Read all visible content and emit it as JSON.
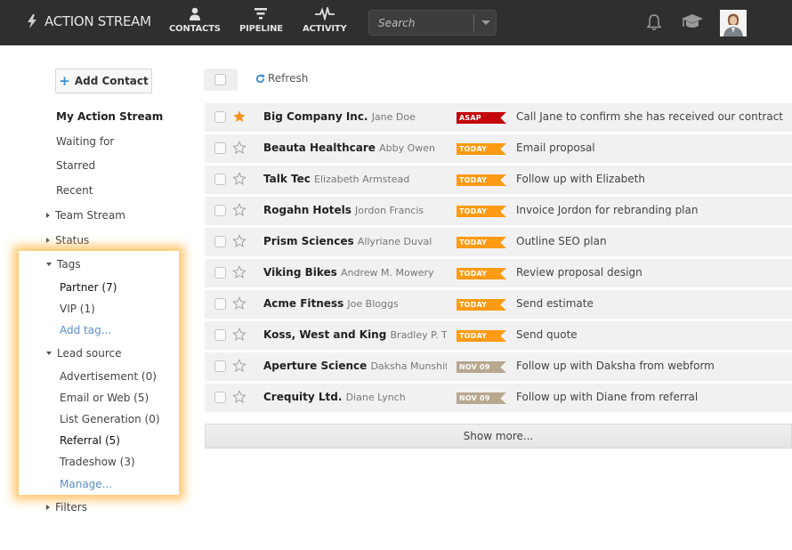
{
  "header": {
    "app_title": "ACTION STREAM",
    "nav": [
      {
        "label": "CONTACTS",
        "icon": "person-icon"
      },
      {
        "label": "PIPELINE",
        "icon": "funnel-icon"
      },
      {
        "label": "ACTIVITY",
        "icon": "pulse-icon"
      }
    ],
    "search": {
      "placeholder": "Search",
      "value": ""
    },
    "icons": [
      "bell-icon",
      "graduation-cap-icon",
      "avatar"
    ]
  },
  "sidebar": {
    "add_contact_label": "Add Contact",
    "items": [
      {
        "label": "My Action Stream",
        "active": true
      },
      {
        "label": "Waiting for"
      },
      {
        "label": "Starred"
      },
      {
        "label": "Recent"
      }
    ],
    "team_stream": "Team Stream",
    "status": "Status",
    "tags": {
      "label": "Tags",
      "items": [
        {
          "label": "Partner (7)"
        },
        {
          "label": "VIP (1)"
        }
      ],
      "add_label": "Add tag..."
    },
    "lead_source": {
      "label": "Lead source",
      "items": [
        {
          "label": "Advertisement (0)"
        },
        {
          "label": "Email or Web (5)"
        },
        {
          "label": "List Generation (0)"
        },
        {
          "label": "Referral (5)"
        },
        {
          "label": "Tradeshow (3)"
        }
      ],
      "manage_label": "Manage..."
    },
    "filters": "Filters"
  },
  "toolbar": {
    "refresh_label": "Refresh"
  },
  "badge_colors": {
    "ASAP": "#c4050a",
    "TODAY": "#ff9a14",
    "NOV 09": "#b8a890"
  },
  "rows": [
    {
      "company": "Big Company Inc.",
      "person": "Jane Doe",
      "starred": true,
      "badge": "ASAP",
      "task": "Call Jane to confirm she has received our contract"
    },
    {
      "company": "Beauta Healthcare",
      "person": "Abby Owen",
      "starred": false,
      "badge": "TODAY",
      "task": "Email proposal"
    },
    {
      "company": "Talk Tec",
      "person": "Elizabeth Armstead",
      "starred": false,
      "badge": "TODAY",
      "task": "Follow up with Elizabeth"
    },
    {
      "company": "Rogahn Hotels",
      "person": "Jordon Francis",
      "starred": false,
      "badge": "TODAY",
      "task": "Invoice Jordon for rebranding plan"
    },
    {
      "company": "Prism Sciences",
      "person": "Allyriane Duval",
      "starred": false,
      "badge": "TODAY",
      "task": "Outline SEO plan"
    },
    {
      "company": "Viking Bikes",
      "person": "Andrew M. Mowery",
      "starred": false,
      "badge": "TODAY",
      "task": "Review proposal design"
    },
    {
      "company": "Acme Fitness",
      "person": "Joe Bloggs",
      "starred": false,
      "badge": "TODAY",
      "task": "Send estimate"
    },
    {
      "company": "Koss, West and King",
      "person": "Bradley P. Thomas",
      "starred": false,
      "badge": "TODAY",
      "task": "Send quote"
    },
    {
      "company": "Aperture Science",
      "person": "Daksha Munshif",
      "starred": false,
      "badge": "NOV 09",
      "task": "Follow up with Daksha from webform"
    },
    {
      "company": "Crequity Ltd.",
      "person": "Diane Lynch",
      "starred": false,
      "badge": "NOV 09",
      "task": "Follow up with Diane from referral"
    }
  ],
  "show_more_label": "Show more..."
}
